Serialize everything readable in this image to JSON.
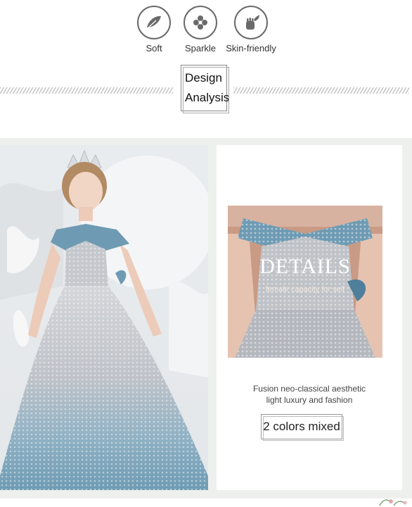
{
  "features": [
    {
      "icon": "feather-leaf-icon",
      "label": "Soft"
    },
    {
      "icon": "sparkle-flower-icon",
      "label": "Sparkle"
    },
    {
      "icon": "hand-leaf-icon",
      "label": "Skin-friendly"
    }
  ],
  "section": {
    "title_line1": "Design",
    "title_line2": "Analysis"
  },
  "details": {
    "heading": "DETAILS",
    "subheading": "female capacity for self",
    "description_line1": "Fusion neo-classical aesthetic",
    "description_line2": "light luxury and fashion",
    "colors_label": "2 colors mixed"
  },
  "colors": {
    "sequin_silver": "#c9cbd0",
    "sequin_blue": "#6e9bb3",
    "panel_bg": "#eef0ee",
    "icon_stroke": "#6a6a6a"
  }
}
